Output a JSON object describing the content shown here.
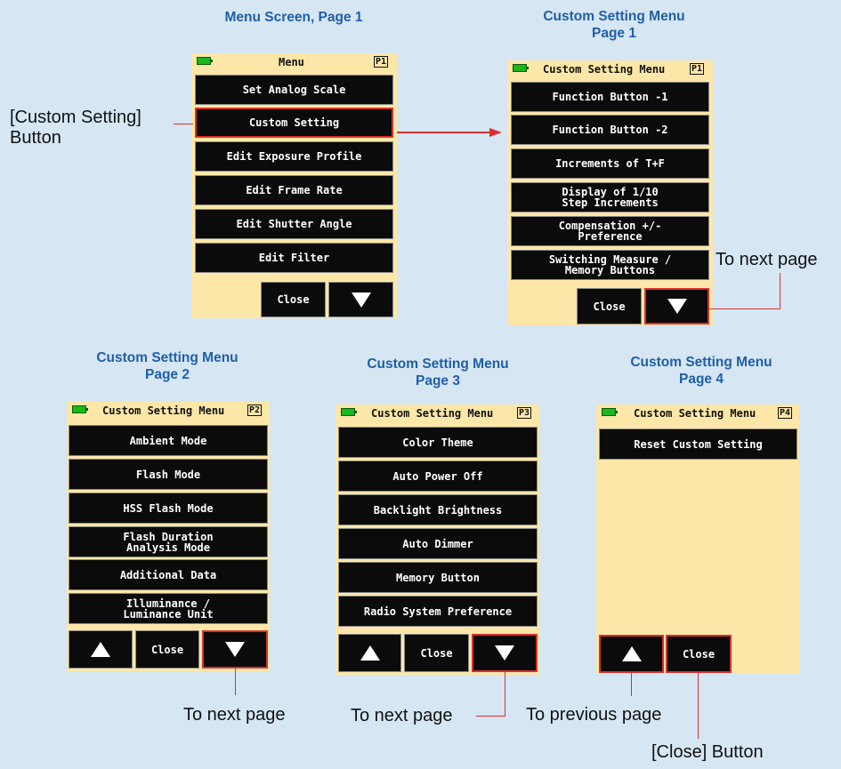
{
  "titles": {
    "menu_p1": "Menu Screen, Page 1",
    "cs_p1_l1": "Custom Setting Menu",
    "cs_p1_l2": "Page 1",
    "cs_p2_l1": "Custom Setting Menu",
    "cs_p2_l2": "Page 2",
    "cs_p3_l1": "Custom Setting Menu",
    "cs_p3_l2": "Page 3",
    "cs_p4_l1": "Custom Setting Menu",
    "cs_p4_l2": "Page 4"
  },
  "menu": {
    "title": "Menu",
    "page": "P1",
    "items": [
      "Set Analog Scale",
      "Custom Setting",
      "Edit Exposure Profile",
      "Edit Frame Rate",
      "Edit Shutter Angle",
      "Edit Filter"
    ],
    "close": "Close"
  },
  "cs1": {
    "title": "Custom Setting Menu",
    "page": "P1",
    "items": [
      "Function Button -1",
      "Function Button -2",
      "Increments of T+F",
      "Display of 1/10\nStep Increments",
      "Compensation +/-\nPreference",
      "Switching Measure /\nMemory Buttons"
    ],
    "close": "Close"
  },
  "cs2": {
    "title": "Custom Setting Menu",
    "page": "P2",
    "items": [
      "Ambient Mode",
      "Flash Mode",
      "HSS Flash Mode",
      "Flash Duration\nAnalysis Mode",
      "Additional Data",
      "Illuminance /\nLuminance Unit"
    ],
    "close": "Close"
  },
  "cs3": {
    "title": "Custom Setting Menu",
    "page": "P3",
    "items": [
      "Color Theme",
      "Auto Power Off",
      "Backlight Brightness",
      "Auto Dimmer",
      "Memory Button",
      "Radio System Preference"
    ],
    "close": "Close"
  },
  "cs4": {
    "title": "Custom Setting Menu",
    "page": "P4",
    "items": [
      "Reset Custom Setting"
    ],
    "close": "Close"
  },
  "labels": {
    "custom_setting_btn_l1": "[Custom Setting]",
    "custom_setting_btn_l2": "Button",
    "to_next_page_1": "To next page",
    "to_next_page_2": "To next page",
    "to_next_page_3": "To next page",
    "to_previous_page": "To previous page",
    "close_button": "[Close] Button"
  },
  "colors": {
    "background": "#d6e6f3",
    "title": "#1f5fa8",
    "screen": "#fde7a8",
    "button": "#0b0b0b",
    "highlight": "#d93030",
    "battery": "#18b818"
  }
}
